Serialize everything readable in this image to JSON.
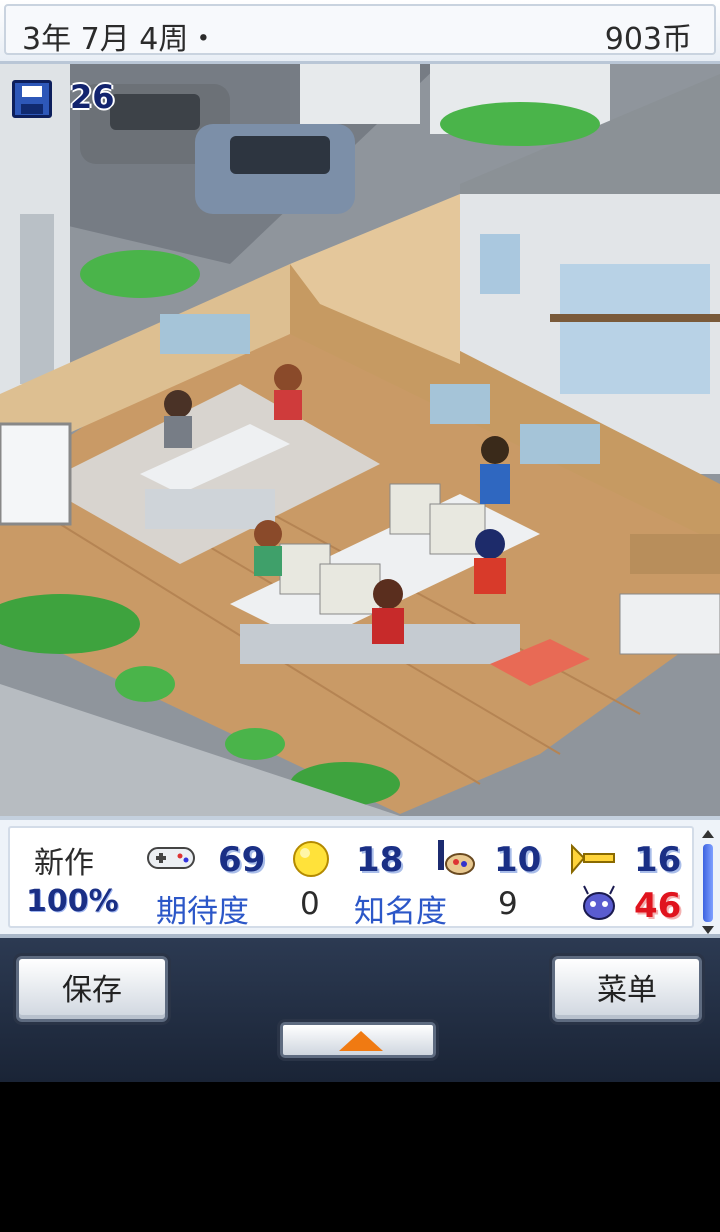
{
  "topbar": {
    "date": "3年 7月 4周・",
    "money": "903币"
  },
  "scene": {
    "save_count": "26"
  },
  "stats": {
    "new_game_label": "新作",
    "progress": "100%",
    "fun": "69",
    "creativity": "18",
    "graphics": "10",
    "sound": "16",
    "expectation_label": "期待度",
    "expectation_value": "0",
    "fame_label": "知名度",
    "fame_value": "9",
    "bugs": "46"
  },
  "buttons": {
    "save_label": "保存",
    "menu_label": "菜单"
  },
  "colors": {
    "stat_number": "#1a2f85",
    "bug_number": "#e0141e",
    "label_blue": "#2c57c8",
    "arrow": "#f07a12"
  }
}
